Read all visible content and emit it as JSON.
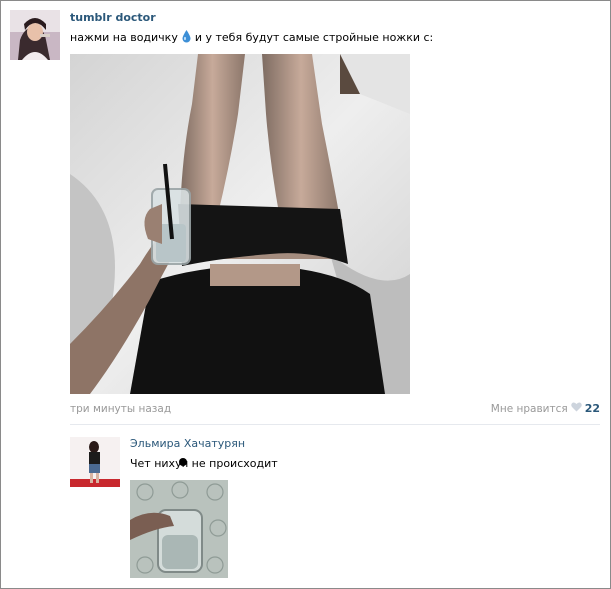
{
  "post": {
    "author": "tumblr doctor",
    "text_before": "нажми на водичку",
    "drop_icon": "water-drop-icon",
    "text_after": "и у тебя будут самые стройные ножки с:",
    "time": "три минуты назад",
    "like_label": "Мне нравится",
    "like_icon": "heart-icon",
    "like_count": "22"
  },
  "comment": {
    "author": "Эльмира Хачатурян",
    "text": "Чет нихуя не происходит"
  },
  "colors": {
    "link": "#2b587a",
    "muted": "#999999",
    "drop": "#3d8fd6"
  }
}
